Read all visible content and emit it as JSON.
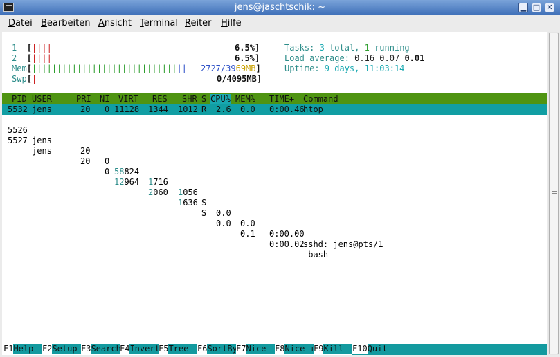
{
  "window": {
    "title": "jens@jaschtschik: ~",
    "buttons": {
      "minimize": "▁",
      "maximize": "□",
      "close": "✕"
    }
  },
  "menu": [
    {
      "label": "Datei",
      "mnemonic": "D",
      "rest": "atei"
    },
    {
      "label": "Bearbeiten",
      "mnemonic": "B",
      "rest": "earbeiten"
    },
    {
      "label": "Ansicht",
      "mnemonic": "A",
      "rest": "nsicht"
    },
    {
      "label": "Terminal",
      "mnemonic": "T",
      "rest": "erminal"
    },
    {
      "label": "Reiter",
      "mnemonic": "R",
      "rest": "eiter"
    },
    {
      "label": "Hilfe",
      "mnemonic": "H",
      "rest": "ilfe"
    }
  ],
  "meters": {
    "cpu1": {
      "label": "1",
      "bars": "||||",
      "value": "6.5%"
    },
    "cpu2": {
      "label": "2",
      "bars": "||||",
      "value": "6.5%"
    },
    "mem": {
      "label": "Mem",
      "bars_green": "|||||||||||||||||||||||||||||",
      "bars_blue": "||",
      "used": "2727",
      "sep": "/39",
      "total_tail": "69MB"
    },
    "swp": {
      "label": "Swp",
      "bars": "|",
      "used": "0",
      "total": "/4095MB"
    }
  },
  "stats": {
    "tasks_label": "Tasks: ",
    "tasks_total": "3",
    "tasks_total_suffix": " total, ",
    "tasks_running": "1",
    "tasks_running_suffix": " running",
    "load_label": "Load average: ",
    "load_1": "0.16",
    "load_5": "0.07",
    "load_15": "0.01",
    "uptime_label": "Uptime: ",
    "uptime_value": "9 days, 11:03:14"
  },
  "table": {
    "columns": {
      "pid": "PID",
      "user": "USER",
      "pri": "PRI",
      "ni": "NI",
      "virt": "VIRT",
      "res": "RES",
      "shr": "SHR",
      "s": "S",
      "cpu": "CPU%",
      "mem": "MEM%",
      "time": "TIME+",
      "command": "Command"
    },
    "rows": [
      {
        "pid": "5532",
        "user": "jens",
        "pri": "20",
        "ni": "0",
        "virt": "11128",
        "res": "1344",
        "shr": "1012",
        "s": "R",
        "cpu": "2.6",
        "mem": "0.0",
        "time": "0:00.46",
        "command": "htop"
      },
      {
        "pid": "5526",
        "user": "jens",
        "pri": "20",
        "ni": "0",
        "virt_hi": "58",
        "virt_lo": "824",
        "res_hi": "1",
        "res_lo": "716",
        "shr_hi": "1",
        "shr_lo": "056",
        "s": "S",
        "cpu": "0.0",
        "mem": "0.0",
        "time": "0:00.00",
        "command": "sshd: jens@pts/1"
      },
      {
        "pid": "5527",
        "user": "jens",
        "pri": "20",
        "ni": "0",
        "virt_hi": "12",
        "virt_lo": "964",
        "res_hi": "2",
        "res_lo": "060",
        "shr_hi": "1",
        "shr_lo": "636",
        "s": "S",
        "cpu": "0.0",
        "mem": "0.1",
        "time": "0:00.02",
        "command": "-bash"
      }
    ]
  },
  "fkeys": [
    {
      "key": "F1",
      "label": "Help  "
    },
    {
      "key": "F2",
      "label": "Setup "
    },
    {
      "key": "F3",
      "label": "Search"
    },
    {
      "key": "F4",
      "label": "Invert"
    },
    {
      "key": "F5",
      "label": "Tree  "
    },
    {
      "key": "F6",
      "label": "SortBy"
    },
    {
      "key": "F7",
      "label": "Nice  "
    },
    {
      "key": "F8",
      "label": "Nice +"
    },
    {
      "key": "F9",
      "label": "Kill  "
    },
    {
      "key": "F10",
      "label": "Quit"
    }
  ]
}
